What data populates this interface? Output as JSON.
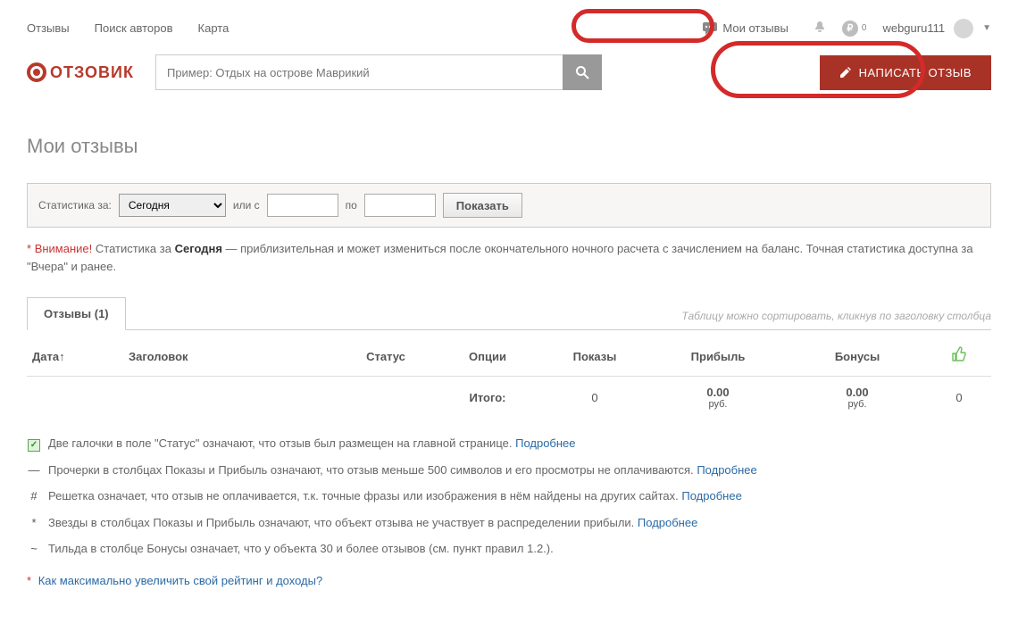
{
  "nav": {
    "reviews": "Отзывы",
    "authors_search": "Поиск авторов",
    "map": "Карта",
    "my_reviews": "Мои отзывы"
  },
  "header": {
    "ruble_symbol": "₽",
    "ruble_count": "0",
    "username": "webguru111"
  },
  "brand": "ОТЗОВИК",
  "search": {
    "placeholder": "Пример: Отдых на острове Маврикий"
  },
  "write_review_btn": "НАПИСАТЬ ОТЗЫВ",
  "page_title": "Мои отзывы",
  "filter": {
    "stats_for": "Статистика за:",
    "period_selected": "Сегодня",
    "or_from": "или с",
    "to": "по",
    "show_btn": "Показать"
  },
  "warning": {
    "star": "*",
    "attention": "Внимание!",
    "t1": "Статистика за",
    "period": "Сегодня",
    "t2": "— приблизительная и может измениться после окончательного ночного расчета с зачислением на баланс. Точная статистика доступна за \"Вчера\" и ранее."
  },
  "tabs": {
    "reviews_tab": "Отзывы (1)",
    "hint": "Таблицу можно сортировать, кликнув по заголовку столбца"
  },
  "table": {
    "headers": {
      "date": "Дата↑",
      "title": "Заголовок",
      "status": "Статус",
      "options": "Опции",
      "views": "Показы",
      "profit": "Прибыль",
      "bonuses": "Бонусы"
    },
    "totals": {
      "label": "Итого:",
      "views": "0",
      "profit_num": "0.00",
      "profit_cur": "руб.",
      "bonuses_num": "0.00",
      "bonuses_cur": "руб.",
      "thumbs": "0"
    }
  },
  "legend": {
    "check": "Две галочки в поле \"Статус\" означают, что отзыв был размещен на главной странице.",
    "dash_sym": "—",
    "dash": "Прочерки в столбцах Показы и Прибыль означают, что отзыв меньше 500 символов и его просмотры не оплачиваются.",
    "hash_sym": "#",
    "hash": "Решетка означает, что отзыв не оплачивается, т.к. точные фразы или изображения в нём найдены на других сайтах.",
    "star_sym": "*",
    "star": "Звезды в столбцах Показы и Прибыль означают, что объект отзыва не участвует в распределении прибыли.",
    "tilde_sym": "~",
    "tilde": "Тильда в столбце Бонусы означает, что у объекта 30 и более отзывов (см. пункт правил 1.2.).",
    "more": "Подробнее"
  },
  "footlink": "Как максимально увеличить свой рейтинг и доходы?"
}
